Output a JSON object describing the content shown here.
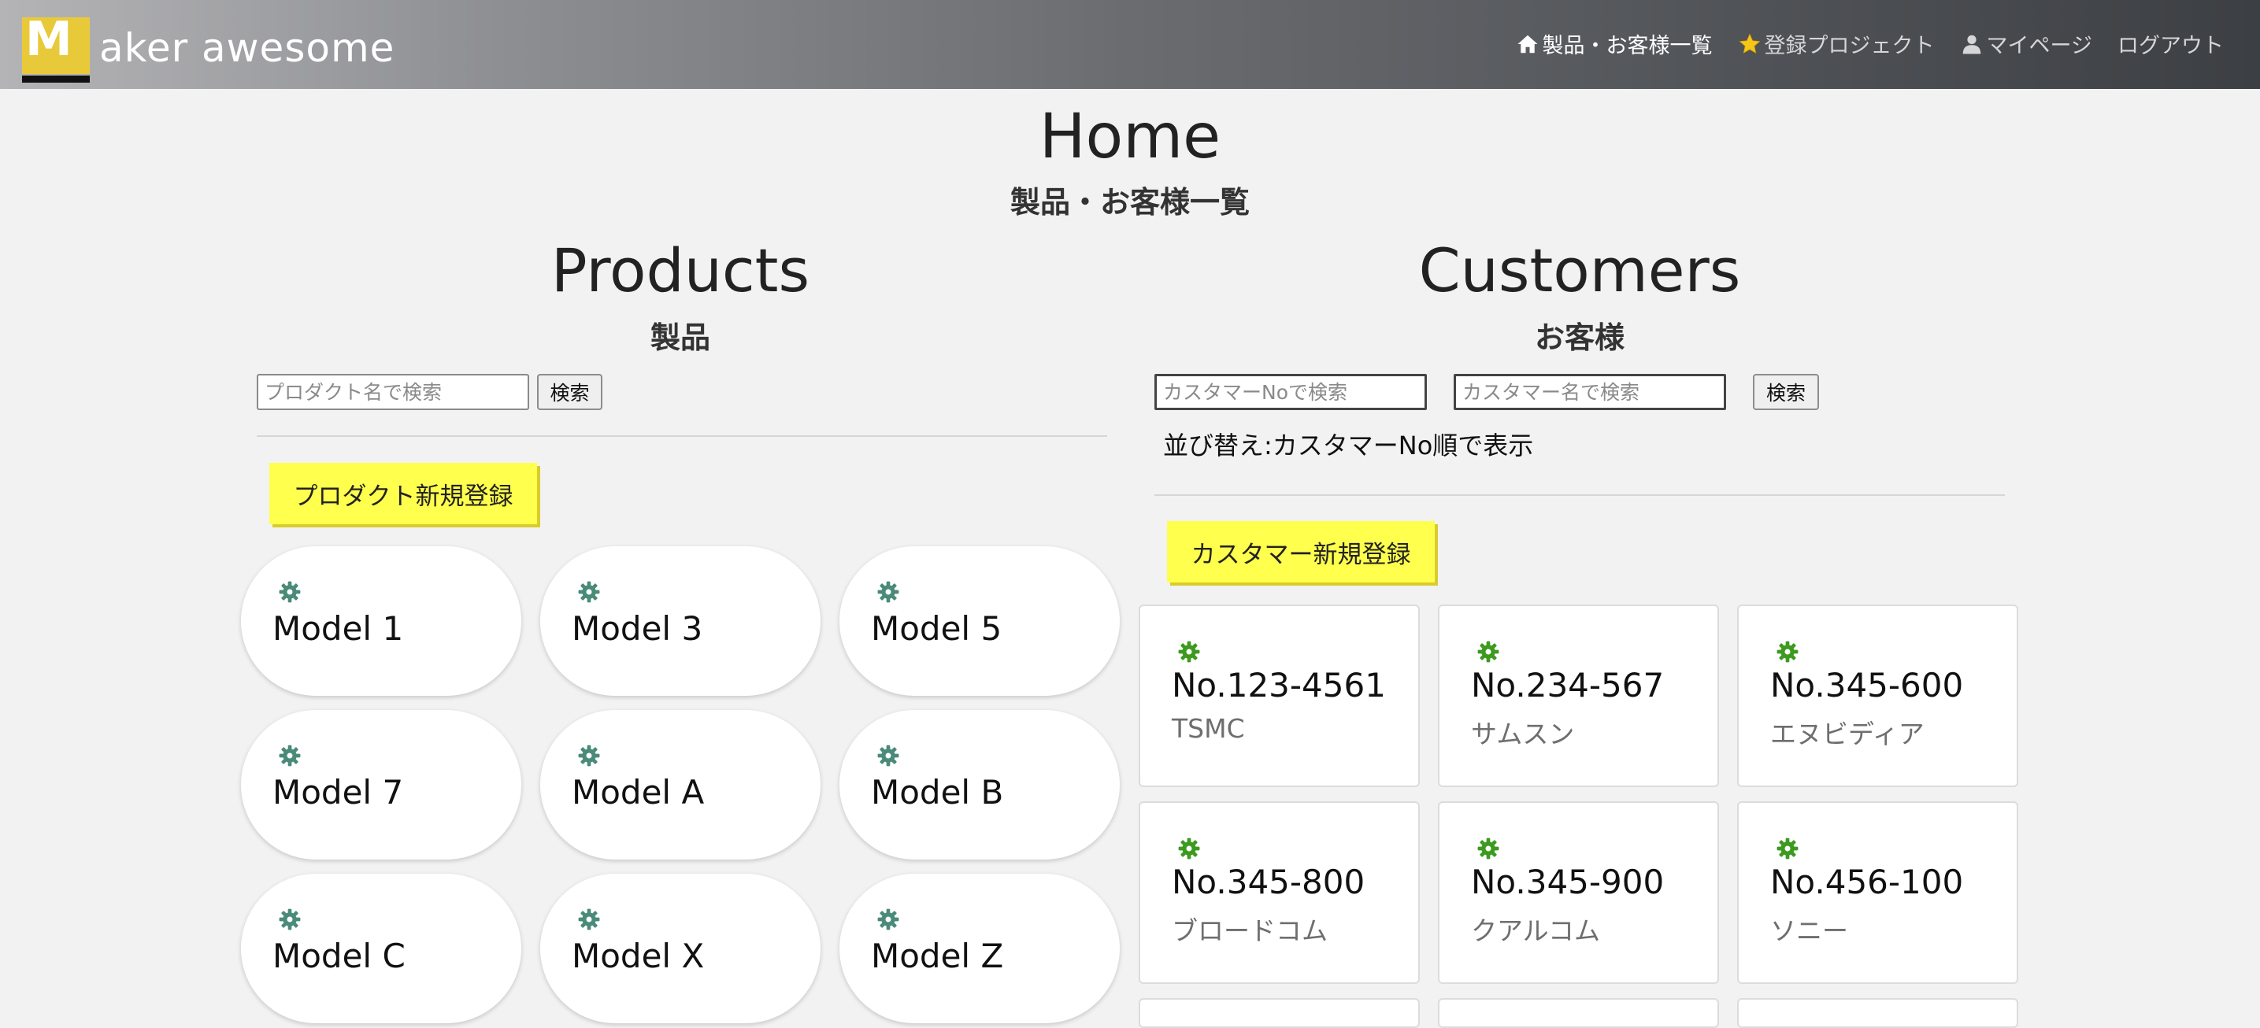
{
  "navbar": {
    "logo_letter": "M",
    "logo_text": "aker awesome",
    "links": [
      {
        "label": "製品・お客様一覧",
        "icon": "home-icon",
        "active": true
      },
      {
        "label": "登録プロジェクト",
        "icon": "star-icon",
        "active": false
      },
      {
        "label": "マイページ",
        "icon": "user-icon",
        "active": false
      },
      {
        "label": "ログアウト",
        "icon": "",
        "active": false
      }
    ]
  },
  "page": {
    "title": "Home",
    "subtitle": "製品・お客様一覧"
  },
  "products": {
    "title": "Products",
    "subtitle": "製品",
    "search_placeholder": "プロダクト名で検索",
    "search_button": "検索",
    "register_button": "プロダクト新規登録",
    "items": [
      "Model 1",
      "Model 3",
      "Model 5",
      "Model 7",
      "Model A",
      "Model B",
      "Model C",
      "Model X",
      "Model Z"
    ]
  },
  "customers": {
    "title": "Customers",
    "subtitle": "お客様",
    "search_no_placeholder": "カスタマーNoで検索",
    "search_name_placeholder": "カスタマー名で検索",
    "search_button": "検索",
    "sort_text": "並び替え:カスタマーNo順で表示",
    "register_button": "カスタマー新規登録",
    "items": [
      {
        "no": "No.123-4561",
        "name": "TSMC"
      },
      {
        "no": "No.234-567",
        "name": "サムスン"
      },
      {
        "no": "No.345-600",
        "name": "エヌビディア"
      },
      {
        "no": "No.345-800",
        "name": "ブロードコム"
      },
      {
        "no": "No.345-900",
        "name": "クアルコム"
      },
      {
        "no": "No.456-100",
        "name": "ソニー"
      }
    ]
  },
  "colors": {
    "accent_yellow": "#ffff4d",
    "logo_yellow": "#e8c93a",
    "gear_green": "#3c9a1f",
    "gear_teal": "#4a8a78"
  }
}
